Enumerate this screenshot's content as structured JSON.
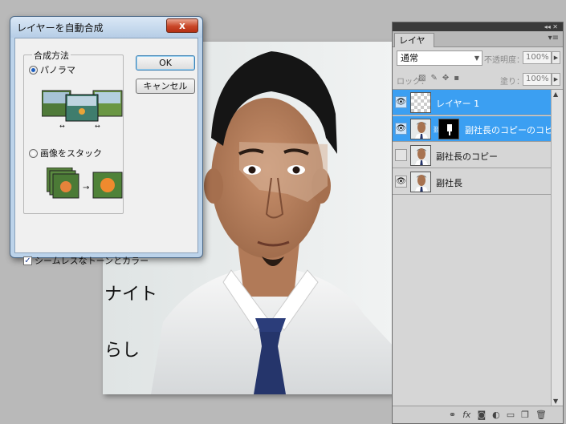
{
  "dialog": {
    "title": "レイヤーを自動合成",
    "close_label": "x",
    "group_label": "合成方法",
    "option_panorama": "パノラマ",
    "option_stack": "画像をスタック",
    "ok_label": "OK",
    "cancel_label": "キャンセル",
    "seamless_label": "シームレスなトーンとカラー",
    "seamless_checked": true,
    "selected_option": "panorama"
  },
  "canvas": {
    "handwriting_1": "ナイト",
    "handwriting_2": "らし"
  },
  "layers_panel": {
    "tab_label": "レイヤー",
    "blend_mode": "通常",
    "opacity_label": "不透明度：",
    "opacity_value": "100%",
    "lock_label": "ロック：",
    "fill_label": "塗り：",
    "fill_value": "100%",
    "layers": [
      {
        "name": "レイヤー 1",
        "selected": true,
        "visible": true,
        "has_mask": false
      },
      {
        "name": "副社長のコピーのコピー",
        "selected": true,
        "visible": true,
        "has_mask": true
      },
      {
        "name": "副社長のコピー",
        "selected": false,
        "visible": false,
        "has_mask": false
      },
      {
        "name": "副社長",
        "selected": false,
        "visible": true,
        "has_mask": false
      }
    ]
  },
  "icons": {
    "eye": "eye-icon",
    "link": "link-icon",
    "fx": "fx-icon",
    "mask": "add-mask-icon",
    "adjustment": "adjustment-icon",
    "group": "group-icon",
    "new_layer": "new-layer-icon",
    "trash": "trash-icon"
  },
  "colors": {
    "selection": "#3b9ff2",
    "dialog_frame": "#bcd3ea",
    "close_button": "#c94628"
  }
}
